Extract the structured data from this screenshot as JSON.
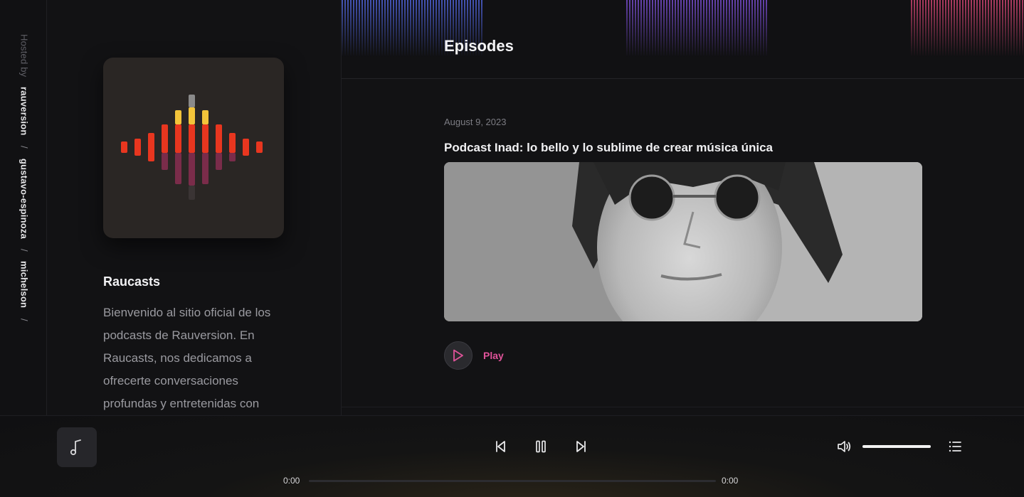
{
  "sidebar": {
    "hosted_by": "Hosted by",
    "crumbs": [
      "rauversion",
      "gustavo-espinoza",
      "michelson"
    ],
    "separator": "/"
  },
  "podcast": {
    "title": "Raucasts",
    "description": "Bienvenido al sitio oficial de los podcasts de Rauversion. En Raucasts, nos dedicamos a ofrecerte conversaciones profundas y entretenidas con"
  },
  "main": {
    "title": "Episodes",
    "episodes": [
      {
        "date": "August 9, 2023",
        "title": "Podcast Inad: lo bello y lo sublime de crear música única",
        "play_label": "Play"
      }
    ]
  },
  "player": {
    "current_time": "0:00",
    "duration": "0:00",
    "progress": 0,
    "volume": 1.0,
    "icons": [
      "music-note-icon",
      "skip-back-icon",
      "pause-icon",
      "skip-forward-icon",
      "volume-icon",
      "queue-list-icon"
    ]
  },
  "colors": {
    "accent": "#e0539a",
    "background": "#121214",
    "bar_red": "#e8361f",
    "bar_yellow": "#f3c43a",
    "bar_purple": "#7a2c4a"
  }
}
